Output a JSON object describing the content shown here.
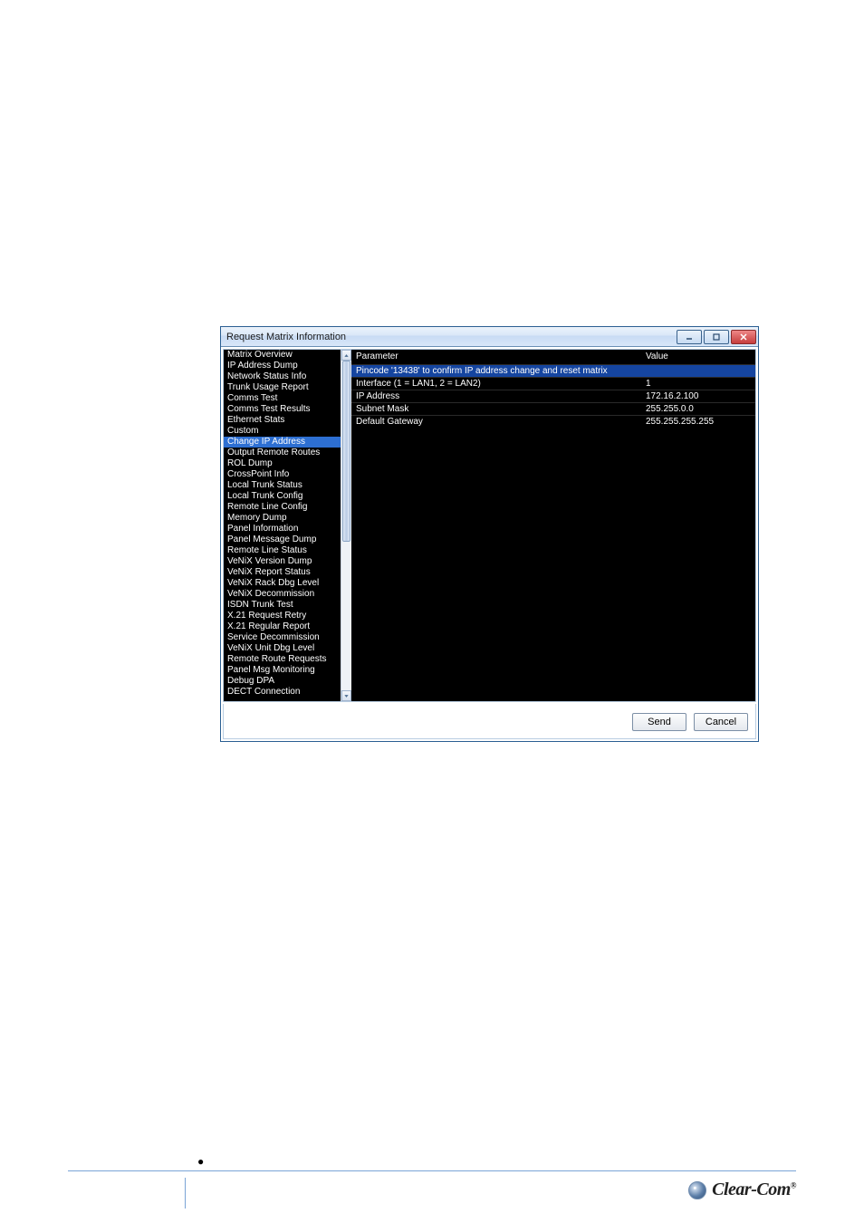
{
  "window": {
    "title": "Request Matrix Information"
  },
  "sidebar": {
    "items": [
      {
        "label": "Matrix Overview",
        "selected": false
      },
      {
        "label": "IP Address Dump",
        "selected": false
      },
      {
        "label": "Network Status Info",
        "selected": false
      },
      {
        "label": "Trunk Usage Report",
        "selected": false
      },
      {
        "label": "Comms Test",
        "selected": false
      },
      {
        "label": "Comms Test Results",
        "selected": false
      },
      {
        "label": "Ethernet Stats",
        "selected": false
      },
      {
        "label": "Custom",
        "selected": false
      },
      {
        "label": "Change IP Address",
        "selected": true
      },
      {
        "label": "Output Remote Routes",
        "selected": false
      },
      {
        "label": "ROL Dump",
        "selected": false
      },
      {
        "label": "CrossPoint Info",
        "selected": false
      },
      {
        "label": "Local Trunk Status",
        "selected": false
      },
      {
        "label": "Local Trunk Config",
        "selected": false
      },
      {
        "label": "Remote Line Config",
        "selected": false
      },
      {
        "label": "Memory Dump",
        "selected": false
      },
      {
        "label": "Panel Information",
        "selected": false
      },
      {
        "label": "Panel Message Dump",
        "selected": false
      },
      {
        "label": "Remote Line Status",
        "selected": false
      },
      {
        "label": "VeNiX Version Dump",
        "selected": false
      },
      {
        "label": "VeNiX Report Status",
        "selected": false
      },
      {
        "label": "VeNiX Rack Dbg Level",
        "selected": false
      },
      {
        "label": "VeNiX Decommission",
        "selected": false
      },
      {
        "label": "ISDN Trunk Test",
        "selected": false
      },
      {
        "label": "X.21 Request Retry",
        "selected": false
      },
      {
        "label": "X.21 Regular Report",
        "selected": false
      },
      {
        "label": "Service Decommission",
        "selected": false
      },
      {
        "label": "VeNiX Unit Dbg Level",
        "selected": false
      },
      {
        "label": "Remote Route Requests",
        "selected": false
      },
      {
        "label": "Panel Msg Monitoring",
        "selected": false
      },
      {
        "label": "Debug DPA",
        "selected": false
      },
      {
        "label": "DECT Connection",
        "selected": false
      }
    ]
  },
  "grid": {
    "header_param": "Parameter",
    "header_value": "Value",
    "rows": [
      {
        "param": "Pincode '13438' to confirm IP address change and reset matrix",
        "value": "",
        "highlight": true
      },
      {
        "param": "Interface (1 = LAN1, 2 = LAN2)",
        "value": "1",
        "highlight": false
      },
      {
        "param": "IP Address",
        "value": "172.16.2.100",
        "highlight": false
      },
      {
        "param": "Subnet Mask",
        "value": "255.255.0.0",
        "highlight": false
      },
      {
        "param": "Default Gateway",
        "value": "255.255.255.255",
        "highlight": false
      }
    ]
  },
  "buttons": {
    "send": "Send",
    "cancel": "Cancel"
  },
  "footer": {
    "brand": "Clear-Com"
  },
  "bullet": "●"
}
